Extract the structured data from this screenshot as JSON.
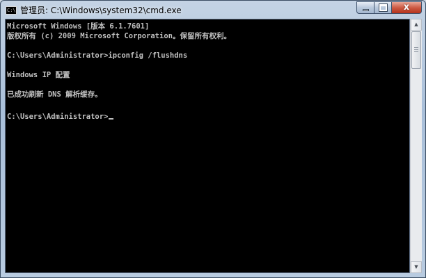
{
  "window": {
    "title": "管理员: C:\\Windows\\system32\\cmd.exe",
    "app_icon_text": "C:\\",
    "close_glyph": "x"
  },
  "console": {
    "lines": [
      "Microsoft Windows [版本 6.1.7601]",
      "版权所有 (c) 2009 Microsoft Corporation。保留所有权利。",
      "",
      "C:\\Users\\Administrator>ipconfig /flushdns",
      "",
      "Windows IP 配置",
      "",
      "已成功刷新 DNS 解析缓存。",
      "",
      "C:\\Users\\Administrator>"
    ]
  },
  "scrollbar": {
    "up_arrow": "▲",
    "down_arrow": "▼"
  }
}
